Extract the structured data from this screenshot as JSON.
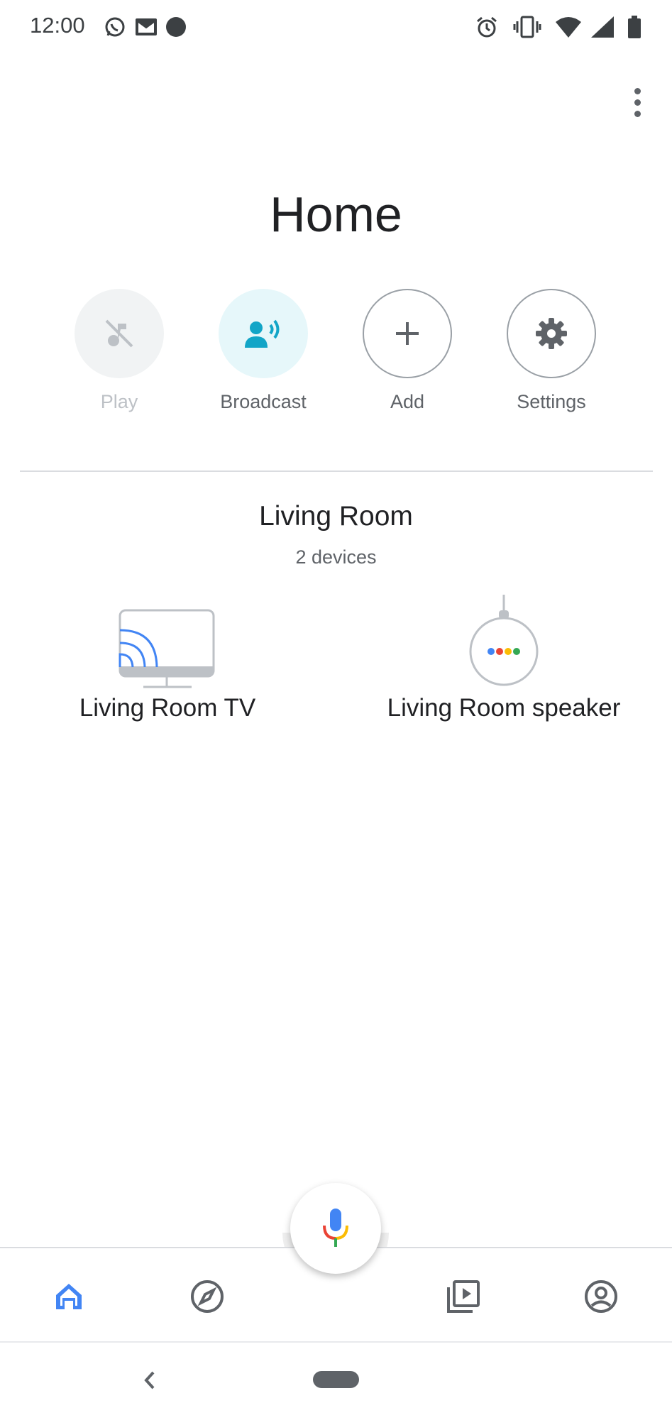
{
  "status_bar": {
    "time": "12:00",
    "left_icons": [
      "whatsapp-icon",
      "gmail-icon",
      "dot-icon"
    ],
    "right_icons": [
      "alarm-icon",
      "vibrate-icon",
      "wifi-icon",
      "signal-icon",
      "battery-icon"
    ]
  },
  "page": {
    "title": "Home"
  },
  "actions": [
    {
      "label": "Play",
      "icon": "music-off-icon",
      "enabled": false
    },
    {
      "label": "Broadcast",
      "icon": "broadcast-icon",
      "enabled": true
    },
    {
      "label": "Add",
      "icon": "plus-icon",
      "enabled": true
    },
    {
      "label": "Settings",
      "icon": "gear-icon",
      "enabled": true
    }
  ],
  "room": {
    "name": "Living Room",
    "device_count": "2 devices",
    "devices": [
      {
        "label": "Living Room TV",
        "icon": "tv-cast-icon"
      },
      {
        "label": "Living Room speaker",
        "icon": "google-home-mini-icon"
      }
    ]
  },
  "bottom_nav": [
    "home-icon",
    "explore-icon",
    "mic-icon",
    "media-icon",
    "account-icon"
  ],
  "colors": {
    "accent_blue": "#4285f4",
    "broadcast_teal": "#12a5c7",
    "broadcast_bg": "#e6f7fa",
    "google_red": "#ea4335",
    "google_yellow": "#fbbc04",
    "google_green": "#34a853"
  }
}
